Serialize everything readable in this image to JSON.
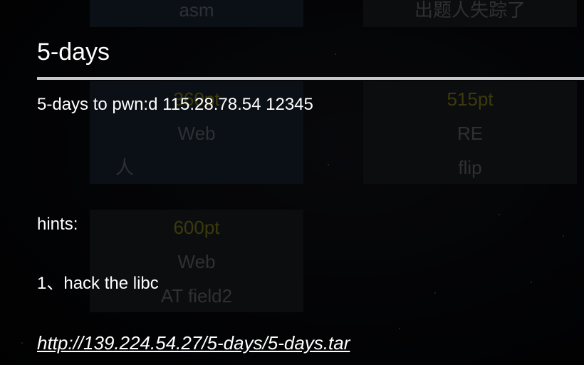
{
  "background": {
    "cards": [
      {
        "id": "asm",
        "lines": [
          "asm"
        ]
      },
      {
        "id": "missing",
        "lines": [
          "出题人失踪了"
        ]
      },
      {
        "id": "web-360",
        "points": "360pt",
        "category": "Web",
        "name": "人"
      },
      {
        "id": "re-515",
        "points": "515pt",
        "category": "RE",
        "name": "flip"
      },
      {
        "id": "web-600",
        "points": "600pt",
        "category": "Web",
        "name": "AT field2"
      }
    ]
  },
  "modal": {
    "title": "5-days",
    "description": "5-days to pwn:d 115.28.78.54 12345",
    "hints_label": "hints:",
    "hint_1": "1、hack the libc",
    "download_url": "http://139.224.54.27/5-days/5-days.tar"
  },
  "colors": {
    "points": "#6d6a16",
    "muted_text": "#54585d",
    "divider": "#c8c8c8",
    "modal_text": "#ffffff"
  }
}
